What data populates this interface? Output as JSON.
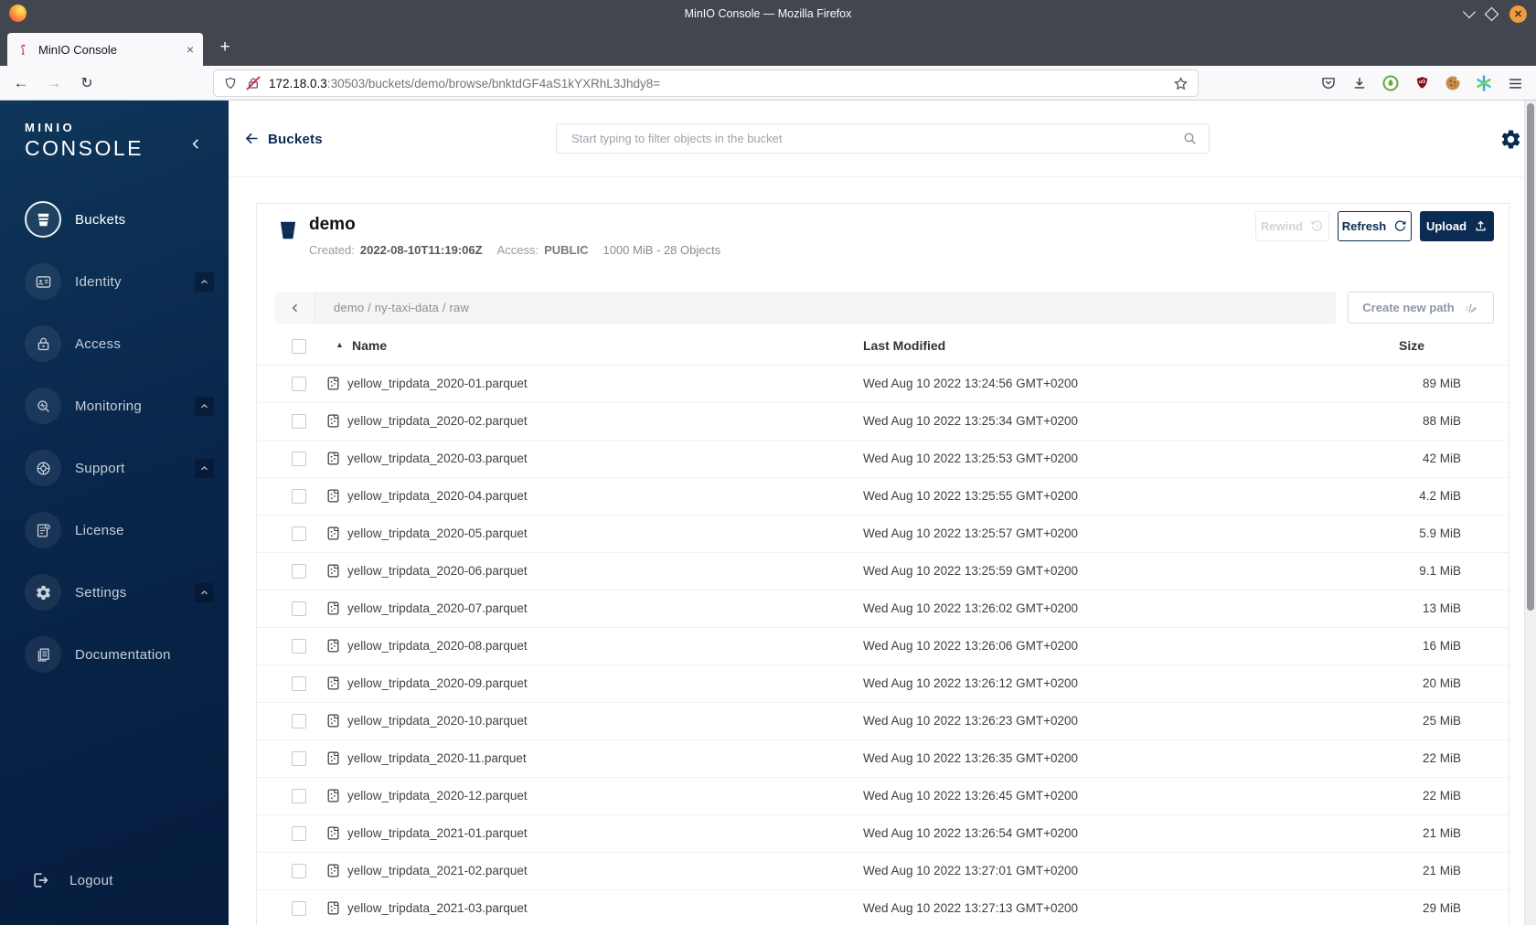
{
  "colors": {
    "navy": "#0a2b54",
    "minio_red": "#c72c48",
    "chrome_dark": "#42464e",
    "toolbar_bg": "#f9f9fb",
    "sidebar_gradient_top": "#0e3659",
    "sidebar_gradient_bottom": "#061c3e",
    "breadcrumb_bg": "#f4f4f4"
  },
  "browser": {
    "window_title": "MinIO Console — Mozilla Firefox",
    "tab_title": "MinIO Console",
    "tab_close_glyph": "×",
    "window_close_glyph": "✕",
    "new_tab_label": "+",
    "back_glyph": "←",
    "forward_glyph": "→",
    "reload_glyph": "↻",
    "url_host": "172.18.0.3",
    "url_path": ":30503/buckets/demo/browse/bnktdGF4aS1kYXRhL3Jhdy8="
  },
  "sidebar": {
    "logo_line1": "MINIO",
    "logo_line2": "CONSOLE",
    "items": [
      {
        "label": "Buckets",
        "icon": "bucket",
        "active": true
      },
      {
        "label": "Identity",
        "icon": "identity",
        "expandable": true
      },
      {
        "label": "Access",
        "icon": "access"
      },
      {
        "label": "Monitoring",
        "icon": "monitoring",
        "expandable": true
      },
      {
        "label": "Support",
        "icon": "support",
        "expandable": true
      },
      {
        "label": "License",
        "icon": "license"
      },
      {
        "label": "Settings",
        "icon": "settings",
        "expandable": true
      },
      {
        "label": "Documentation",
        "icon": "documentation"
      }
    ],
    "logout_label": "Logout"
  },
  "header": {
    "back_label": "Buckets",
    "search_placeholder": "Start typing to filter objects in the bucket"
  },
  "bucket": {
    "name": "demo",
    "created_label": "Created:",
    "created_value": "2022-08-10T11:19:06Z",
    "access_label": "Access:",
    "access_value": "PUBLIC",
    "objects_summary": "1000 MiB - 28 Objects",
    "rewind_label": "Rewind",
    "refresh_label": "Refresh",
    "upload_label": "Upload"
  },
  "browse": {
    "path": "demo / ny-taxi-data / raw",
    "create_path_label": "Create new path"
  },
  "table": {
    "sort_indicator": "▲",
    "name_header": "Name",
    "modified_header": "Last Modified",
    "size_header": "Size",
    "rows": [
      {
        "name": "yellow_tripdata_2020-01.parquet",
        "modified": "Wed Aug 10 2022 13:24:56 GMT+0200",
        "size": "89 MiB"
      },
      {
        "name": "yellow_tripdata_2020-02.parquet",
        "modified": "Wed Aug 10 2022 13:25:34 GMT+0200",
        "size": "88 MiB"
      },
      {
        "name": "yellow_tripdata_2020-03.parquet",
        "modified": "Wed Aug 10 2022 13:25:53 GMT+0200",
        "size": "42 MiB"
      },
      {
        "name": "yellow_tripdata_2020-04.parquet",
        "modified": "Wed Aug 10 2022 13:25:55 GMT+0200",
        "size": "4.2 MiB"
      },
      {
        "name": "yellow_tripdata_2020-05.parquet",
        "modified": "Wed Aug 10 2022 13:25:57 GMT+0200",
        "size": "5.9 MiB"
      },
      {
        "name": "yellow_tripdata_2020-06.parquet",
        "modified": "Wed Aug 10 2022 13:25:59 GMT+0200",
        "size": "9.1 MiB"
      },
      {
        "name": "yellow_tripdata_2020-07.parquet",
        "modified": "Wed Aug 10 2022 13:26:02 GMT+0200",
        "size": "13 MiB"
      },
      {
        "name": "yellow_tripdata_2020-08.parquet",
        "modified": "Wed Aug 10 2022 13:26:06 GMT+0200",
        "size": "16 MiB"
      },
      {
        "name": "yellow_tripdata_2020-09.parquet",
        "modified": "Wed Aug 10 2022 13:26:12 GMT+0200",
        "size": "20 MiB"
      },
      {
        "name": "yellow_tripdata_2020-10.parquet",
        "modified": "Wed Aug 10 2022 13:26:23 GMT+0200",
        "size": "25 MiB"
      },
      {
        "name": "yellow_tripdata_2020-11.parquet",
        "modified": "Wed Aug 10 2022 13:26:35 GMT+0200",
        "size": "22 MiB"
      },
      {
        "name": "yellow_tripdata_2020-12.parquet",
        "modified": "Wed Aug 10 2022 13:26:45 GMT+0200",
        "size": "22 MiB"
      },
      {
        "name": "yellow_tripdata_2021-01.parquet",
        "modified": "Wed Aug 10 2022 13:26:54 GMT+0200",
        "size": "21 MiB"
      },
      {
        "name": "yellow_tripdata_2021-02.parquet",
        "modified": "Wed Aug 10 2022 13:27:01 GMT+0200",
        "size": "21 MiB"
      },
      {
        "name": "yellow_tripdata_2021-03.parquet",
        "modified": "Wed Aug 10 2022 13:27:13 GMT+0200",
        "size": "29 MiB"
      }
    ]
  }
}
